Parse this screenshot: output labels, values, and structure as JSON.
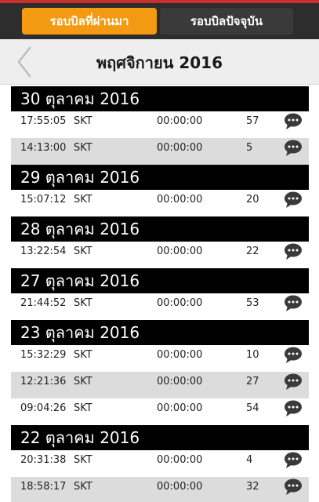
{
  "tabs": {
    "past_label": "รอบบิลที่ผ่านมา",
    "current_label": "รอบบิลปัจจุบัน"
  },
  "month": {
    "title": "พฤศจิกายน 2016"
  },
  "groups": [
    {
      "date": "30 ตุลาคม 2016",
      "rows": [
        {
          "time": "17:55:05",
          "network": "SKT",
          "duration": "00:00:00",
          "count": "57"
        },
        {
          "time": "14:13:00",
          "network": "SKT",
          "duration": "00:00:00",
          "count": "5"
        }
      ]
    },
    {
      "date": "29 ตุลาคม 2016",
      "rows": [
        {
          "time": "15:07:12",
          "network": "SKT",
          "duration": "00:00:00",
          "count": "20"
        }
      ]
    },
    {
      "date": "28 ตุลาคม 2016",
      "rows": [
        {
          "time": "13:22:54",
          "network": "SKT",
          "duration": "00:00:00",
          "count": "22"
        }
      ]
    },
    {
      "date": "27 ตุลาคม 2016",
      "rows": [
        {
          "time": "21:44:52",
          "network": "SKT",
          "duration": "00:00:00",
          "count": "53"
        }
      ]
    },
    {
      "date": "23 ตุลาคม 2016",
      "rows": [
        {
          "time": "15:32:29",
          "network": "SKT",
          "duration": "00:00:00",
          "count": "10"
        },
        {
          "time": "12:21:36",
          "network": "SKT",
          "duration": "00:00:00",
          "count": "27"
        },
        {
          "time": "09:04:26",
          "network": "SKT",
          "duration": "00:00:00",
          "count": "54"
        }
      ]
    },
    {
      "date": "22 ตุลาคม 2016",
      "rows": [
        {
          "time": "20:31:38",
          "network": "SKT",
          "duration": "00:00:00",
          "count": "4"
        },
        {
          "time": "18:58:17",
          "network": "SKT",
          "duration": "00:00:00",
          "count": "32"
        }
      ]
    }
  ],
  "icons": {
    "back": "chevron-left-icon",
    "message": "chat-bubble-icon"
  },
  "colors": {
    "accent": "#f39a12",
    "topbar": "#2d2d2d",
    "top_accent": "#c8312b",
    "header_bg": "#000000",
    "row_alt": "#dcdcdc"
  }
}
